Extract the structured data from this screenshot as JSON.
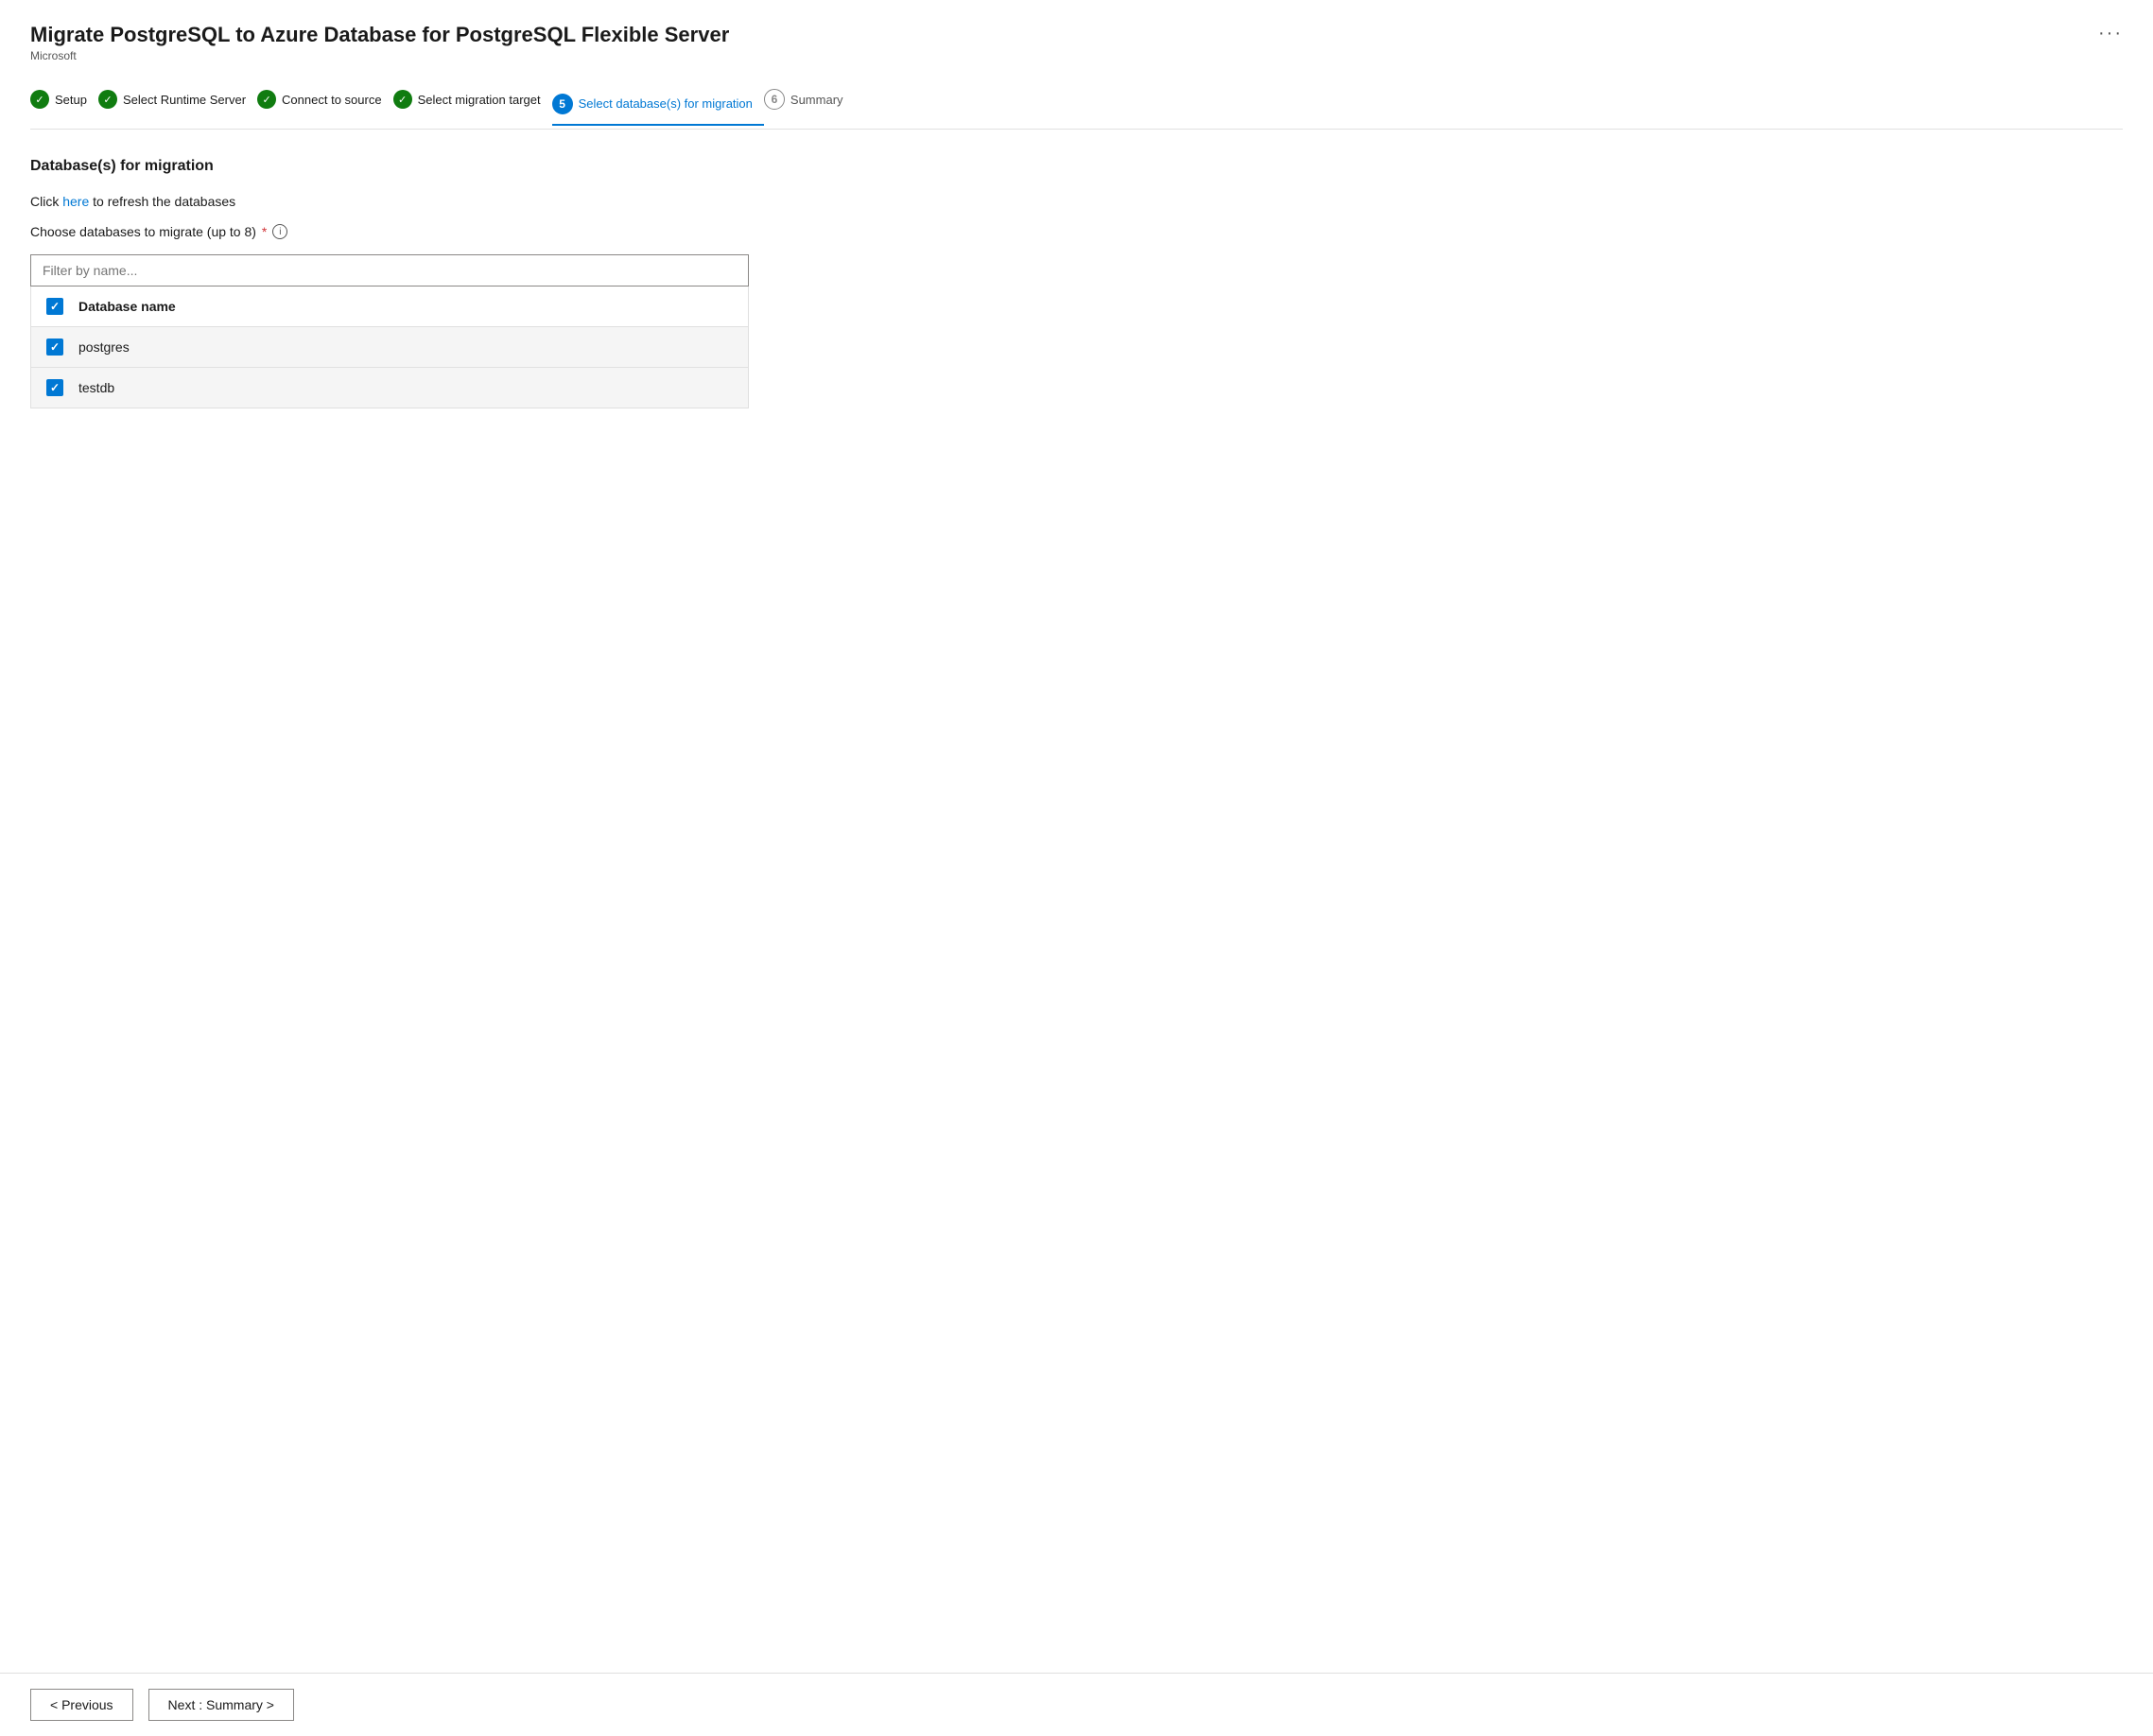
{
  "app": {
    "title": "Migrate PostgreSQL to Azure Database for PostgreSQL Flexible Server",
    "subtitle": "Microsoft",
    "more_options": "···"
  },
  "wizard": {
    "steps": [
      {
        "id": "setup",
        "label": "Setup",
        "state": "completed",
        "number": "1"
      },
      {
        "id": "select-runtime-server",
        "label": "Select Runtime Server",
        "state": "completed",
        "number": "2"
      },
      {
        "id": "connect-to-source",
        "label": "Connect to source",
        "state": "completed",
        "number": "3"
      },
      {
        "id": "select-migration-target",
        "label": "Select migration target",
        "state": "completed",
        "number": "4"
      },
      {
        "id": "select-databases",
        "label": "Select database(s) for migration",
        "state": "active",
        "number": "5"
      },
      {
        "id": "summary",
        "label": "Summary",
        "state": "pending",
        "number": "6"
      }
    ]
  },
  "section": {
    "title": "Database(s) for migration",
    "refresh_text_before": "Click ",
    "refresh_link": "here",
    "refresh_text_after": " to refresh the databases",
    "choose_label": "Choose databases to migrate (up to 8)",
    "required_marker": "*",
    "filter_placeholder": "Filter by name...",
    "table": {
      "header_label": "Database name",
      "rows": [
        {
          "name": "postgres",
          "checked": true
        },
        {
          "name": "testdb",
          "checked": true
        }
      ]
    }
  },
  "footer": {
    "previous_label": "< Previous",
    "next_label": "Next : Summary >"
  }
}
